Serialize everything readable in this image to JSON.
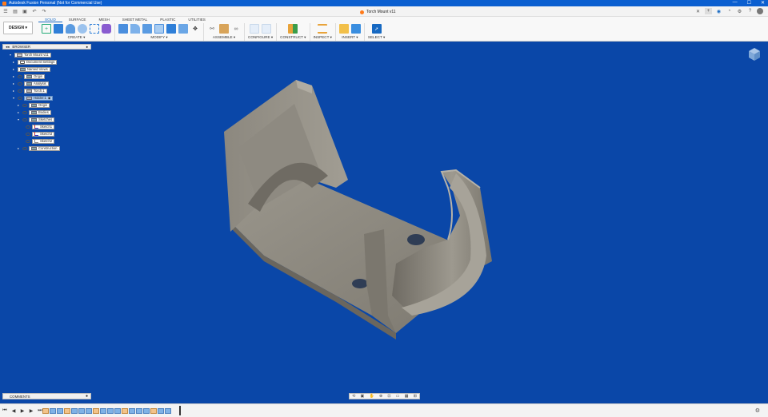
{
  "app": {
    "title": "Autodesk Fusion Personal (Not for Commercial Use)",
    "window_controls": [
      "—",
      "☐",
      "✕"
    ]
  },
  "document": {
    "tab_title": "Torch Mount v11"
  },
  "quick_access": {
    "undo_label": "↶",
    "redo_label": "↷"
  },
  "toolbar_right": {
    "icons": [
      "add-tab-icon",
      "extensions-icon",
      "job-status-icon",
      "notifications-icon",
      "help-icon",
      "user-avatar"
    ]
  },
  "ribbon": {
    "workspace": "DESIGN ▾",
    "tabs": [
      "SOLID",
      "SURFACE",
      "MESH",
      "SHEET METAL",
      "PLASTIC",
      "UTILITIES"
    ],
    "active_tab": "SOLID",
    "groups": [
      {
        "label": "CREATE ▾"
      },
      {
        "label": "MODIFY ▾"
      },
      {
        "label": "ASSEMBLE ▾"
      },
      {
        "label": "CONFIGURE ▾"
      },
      {
        "label": "CONSTRUCT ▾"
      },
      {
        "label": "INSPECT ▾"
      },
      {
        "label": "INSERT ▾"
      },
      {
        "label": "SELECT ▾"
      }
    ]
  },
  "browser": {
    "title": "BROWSER",
    "nodes": [
      {
        "label": "Torch Mount v11"
      },
      {
        "label": "Document Settings"
      },
      {
        "label": "Named Views"
      },
      {
        "label": "Origin"
      },
      {
        "label": "Analysis"
      },
      {
        "label": "Torch:1"
      },
      {
        "label": "Holder:1"
      },
      {
        "label": "Origin"
      },
      {
        "label": "Bodies"
      },
      {
        "label": "Sketches"
      },
      {
        "label": "Sketch1"
      },
      {
        "label": "Sketch3"
      },
      {
        "label": "Sketch2"
      },
      {
        "label": "Construction"
      }
    ]
  },
  "comments": {
    "label": "COMMENTS"
  },
  "colors": {
    "viewport": "#0a47a8",
    "accent": "#1769c2",
    "titlebar": "#0b5fd0",
    "model": "#8a867c"
  }
}
